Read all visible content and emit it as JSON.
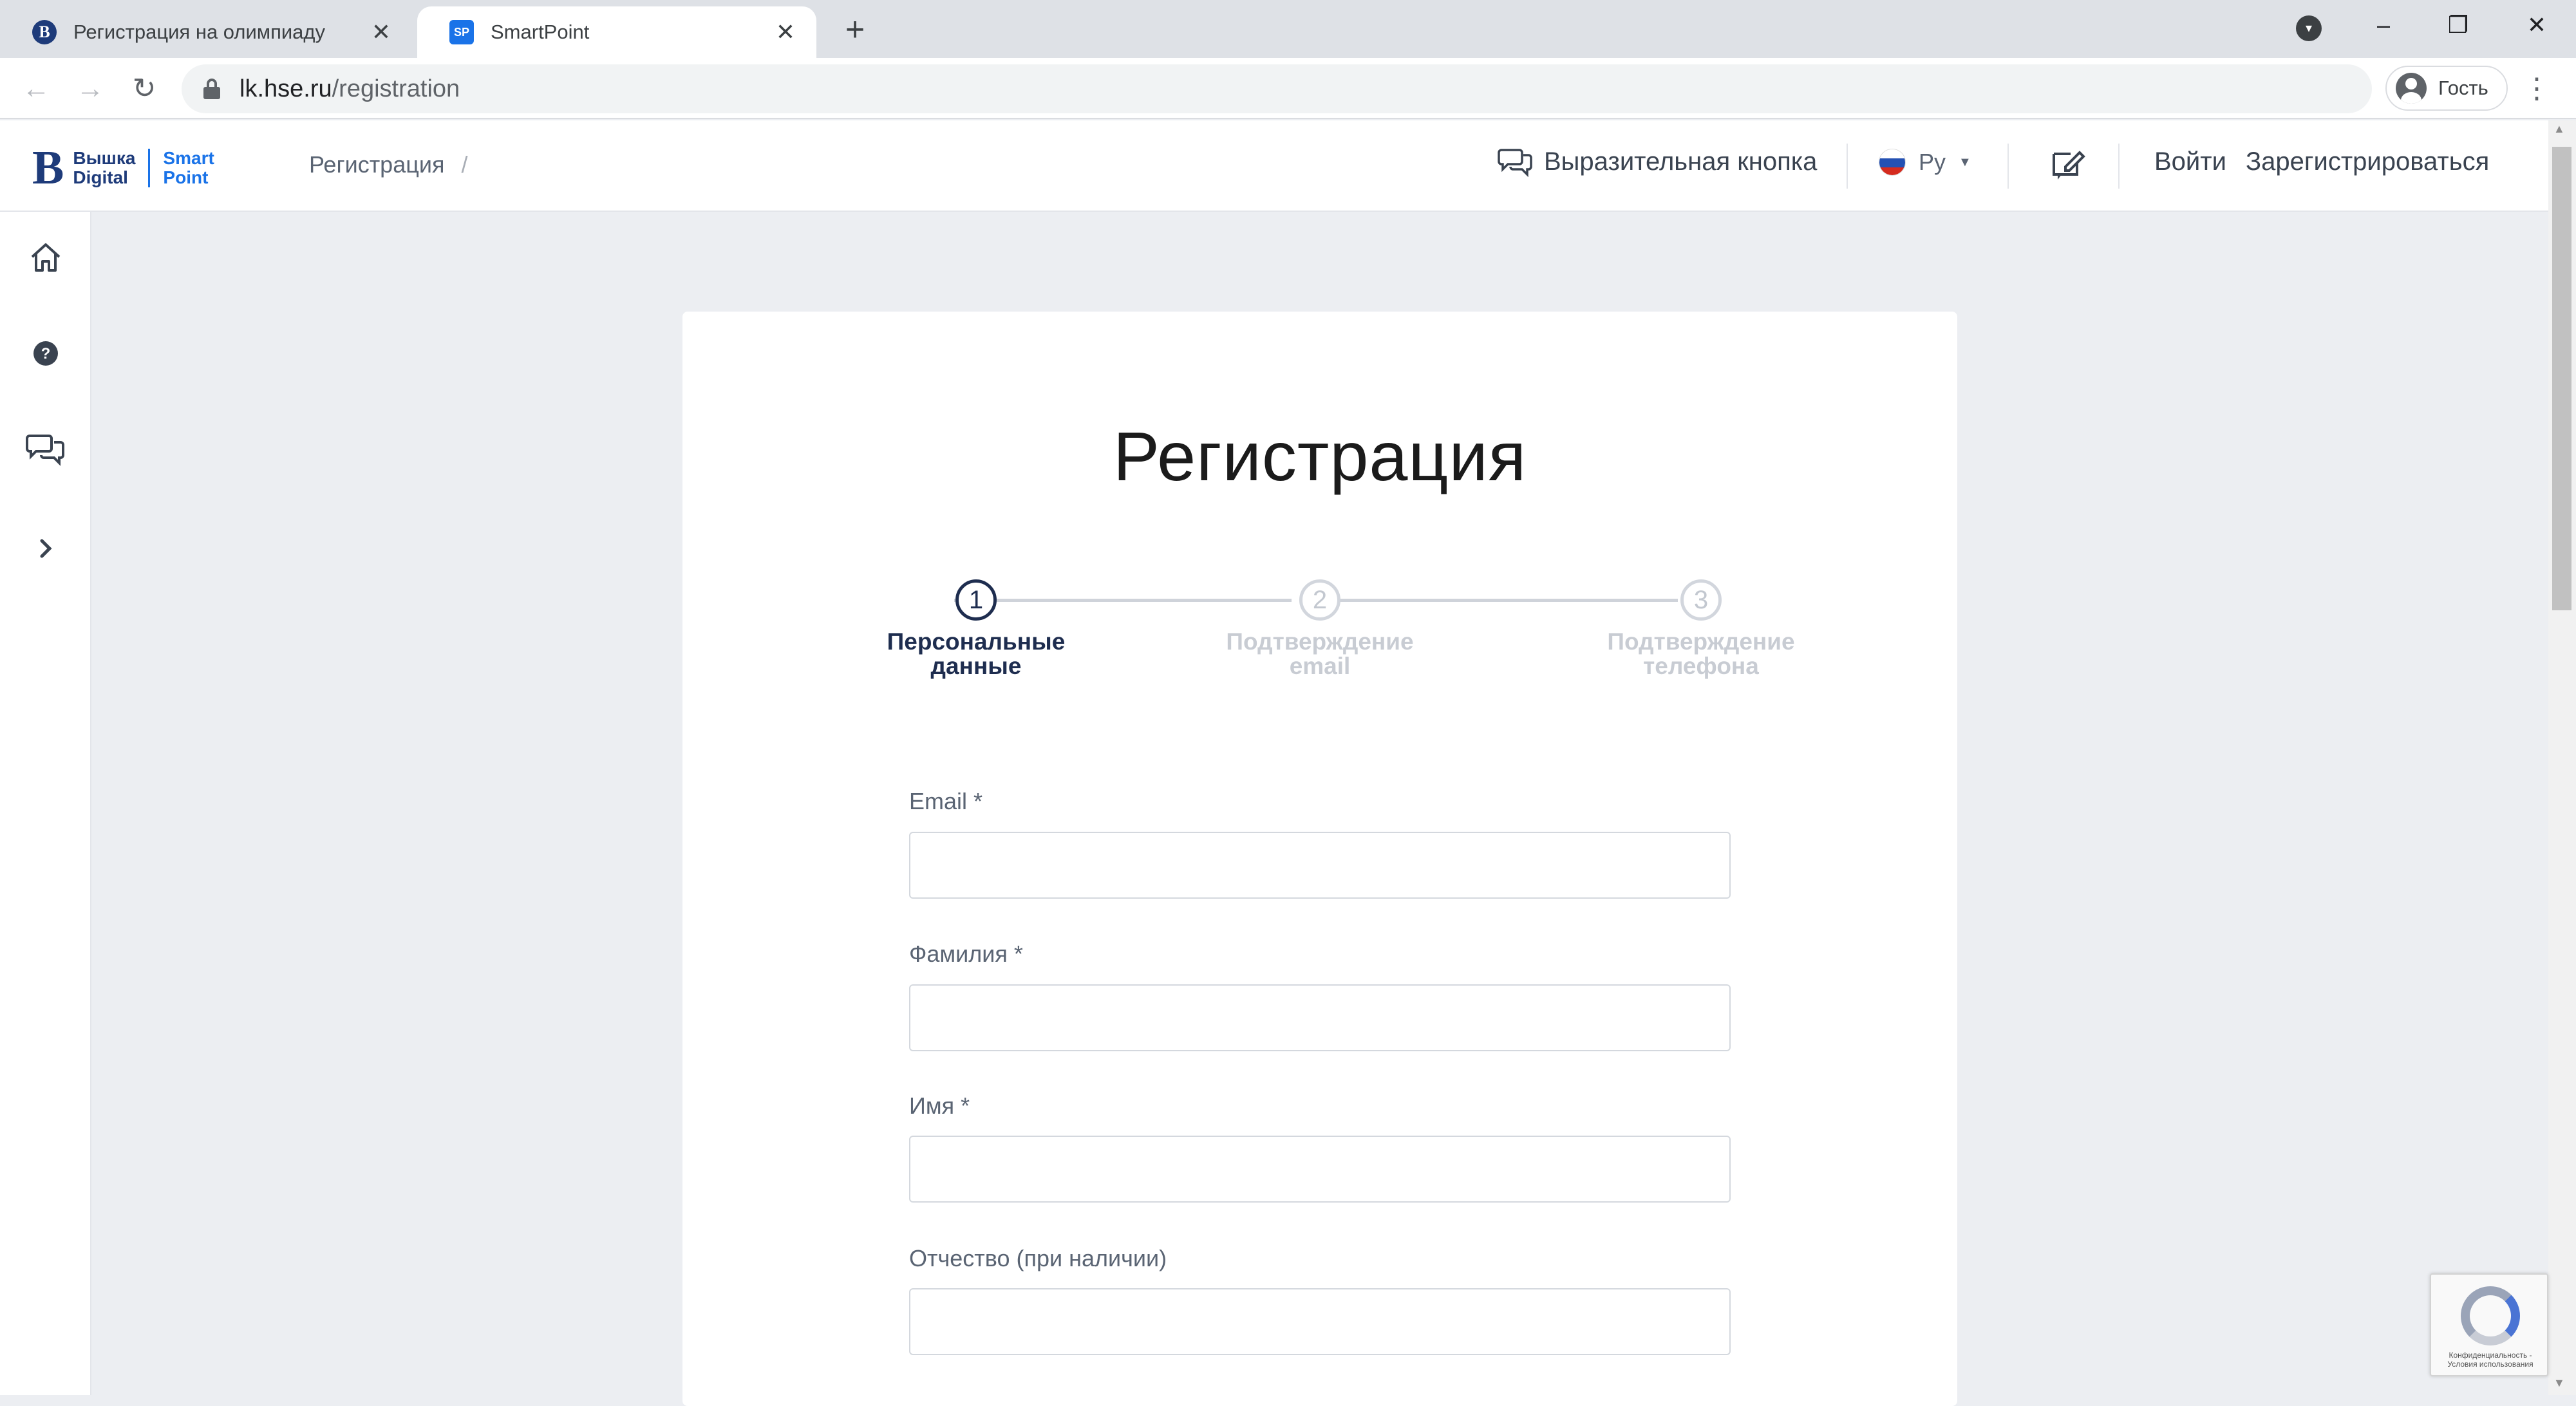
{
  "browser": {
    "tabs": [
      {
        "title": "Регистрация на олимпиаду",
        "favicon": "hse-logo-icon",
        "active": false
      },
      {
        "title": "SmartPoint",
        "favicon": "SP",
        "active": true
      }
    ],
    "new_tab_symbol": "+",
    "url_domain": "lk.hse.ru",
    "url_path": "/registration",
    "profile_label": "Гость"
  },
  "header": {
    "logo": {
      "line1": "Вышка",
      "line2": "Digital",
      "line3": "Smart",
      "line4": "Point"
    },
    "breadcrumb": {
      "label": "Регистрация",
      "separator": "/"
    },
    "chat_button": "Выразительная кнопка",
    "language": {
      "label": "Ру",
      "flag": "ru-flag"
    },
    "login": "Войти",
    "register": "Зарегистрироваться"
  },
  "sidebar": {
    "icons": [
      "home-icon",
      "help-icon",
      "chat-icon",
      "chevron-right-icon"
    ]
  },
  "main": {
    "title": "Регистрация",
    "steps": [
      {
        "number": "1",
        "line1": "Персональные",
        "line2": "данные",
        "active": true
      },
      {
        "number": "2",
        "line1": "Подтверждение",
        "line2": "email",
        "active": false
      },
      {
        "number": "3",
        "line1": "Подтверждение",
        "line2": "телефона",
        "active": false
      }
    ],
    "fields": [
      {
        "label": "Email *",
        "value": "",
        "placeholder": ""
      },
      {
        "label": "Фамилия *",
        "value": "",
        "placeholder": ""
      },
      {
        "label": "Имя *",
        "value": "",
        "placeholder": ""
      },
      {
        "label": "Отчество (при наличии)",
        "value": "",
        "placeholder": ""
      }
    ]
  },
  "recaptcha": {
    "text": "Конфиденциальность - Условия использования"
  },
  "colors": {
    "brand": "#1e3b7a",
    "accent": "#1a73e8",
    "page_bg": "#eceef2",
    "step_active": "#1e2d4f"
  }
}
